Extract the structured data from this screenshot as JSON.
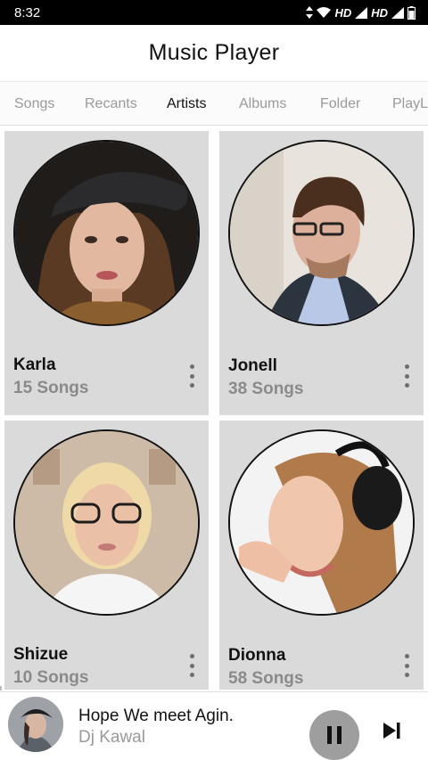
{
  "status_bar": {
    "time": "8:32",
    "network1": "HD",
    "network2": "HD"
  },
  "app": {
    "title": "Music Player"
  },
  "tabs": [
    {
      "label": "Songs",
      "active": false
    },
    {
      "label": "Recants",
      "active": false
    },
    {
      "label": "Artists",
      "active": true
    },
    {
      "label": "Albums",
      "active": false
    },
    {
      "label": "Folder",
      "active": false
    },
    {
      "label": "PlayL",
      "active": false
    }
  ],
  "artists": [
    {
      "name": "Karla",
      "songs": "15 Songs"
    },
    {
      "name": "Jonell",
      "songs": "38 Songs"
    },
    {
      "name": "Shizue",
      "songs": "10 Songs"
    },
    {
      "name": "Dionna",
      "songs": "58 Songs"
    }
  ],
  "now_playing": {
    "title": "Hope We meet Agin.",
    "artist": "Dj Kawal"
  },
  "colors": {
    "card_bg": "#dadada",
    "active_tab": "#111111",
    "inactive_tab": "#9a9a9a",
    "pause_button": "#9e9e9e"
  },
  "icons": {
    "wifi": "wifi-icon",
    "signal": "cell-signal-icon",
    "battery": "battery-icon",
    "more": "more-vertical-icon",
    "pause": "pause-icon",
    "next": "skip-next-icon"
  }
}
